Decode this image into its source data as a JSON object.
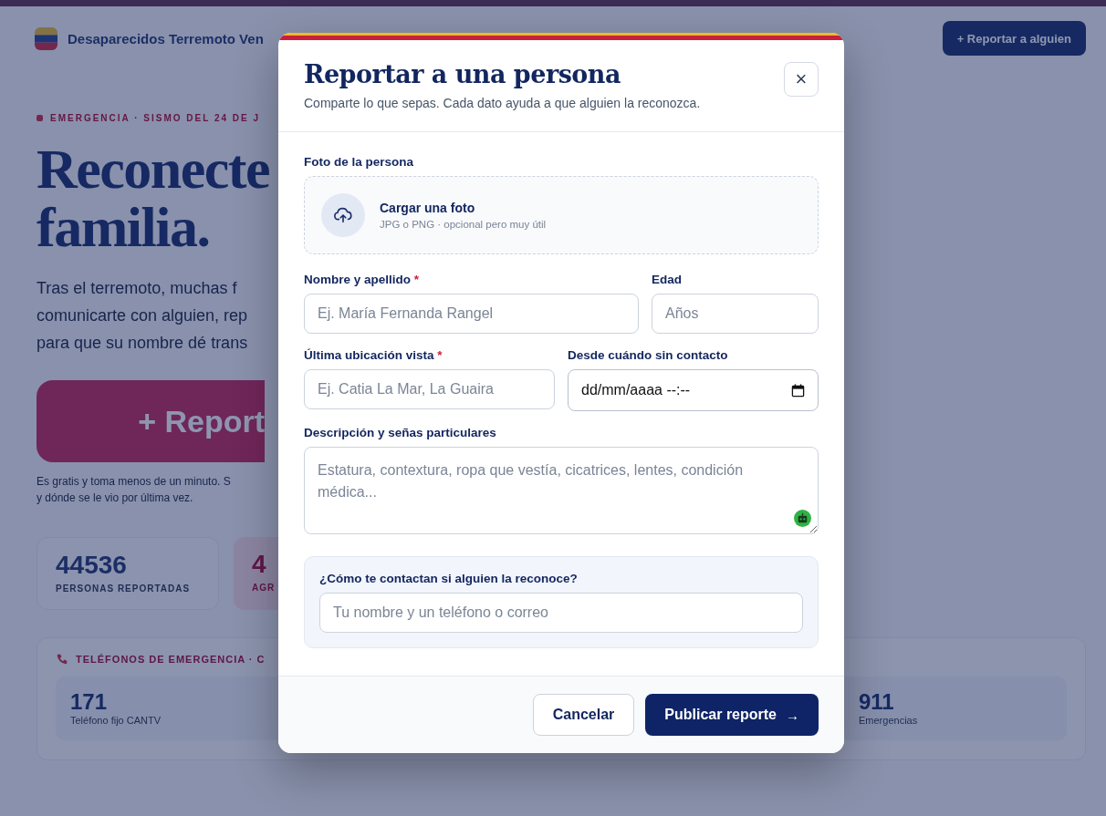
{
  "page": {
    "brand": "Desaparecidos Terremoto Ven",
    "header_button": {
      "icon": "+",
      "label": "Reportar a alguien"
    },
    "eyebrow": "EMERGENCIA · SISMO DEL 24 DE J",
    "headline": [
      "Reconecte",
      "familia."
    ],
    "intro": [
      "Tras el terremoto, muchas f",
      "comunicarte con alguien, rep",
      "para que su nombre dé trans"
    ],
    "cta": {
      "icon": "+",
      "label": "Report"
    },
    "cta_note": [
      "Es gratis y toma menos de un minuto. S",
      "y dónde se le vio por última vez."
    ],
    "stats": [
      {
        "value": "44536",
        "label": "PERSONAS REPORTADAS",
        "kind": "plain"
      },
      {
        "value": "4",
        "label": "AGR",
        "kind": "alert"
      }
    ],
    "phones": {
      "title": "TELÉFONOS DE EMERGENCIA · C",
      "items": [
        {
          "number": "171",
          "label": "Teléfono fijo CANTV"
        },
        {
          "number": "911",
          "label": "Emergencias"
        }
      ]
    }
  },
  "modal": {
    "required_mark": "*",
    "title": "Reportar a una persona",
    "subtitle": "Comparte lo que sepas. Cada dato ayuda a que alguien la reconozca.",
    "close": "×",
    "photo": {
      "label": "Foto de la persona",
      "title": "Cargar una foto",
      "hint": "JPG o PNG · opcional pero muy útil"
    },
    "rows": [
      [
        {
          "kind": "text",
          "label": "Nombre y apellido",
          "required": true,
          "placeholder": "Ej. María Fernanda Rangel"
        },
        {
          "kind": "text",
          "label": "Edad",
          "required": false,
          "placeholder": "Años"
        }
      ],
      [
        {
          "kind": "text",
          "label": "Última ubicación vista",
          "required": true,
          "placeholder": "Ej. Catia La Mar, La Guaira"
        },
        {
          "kind": "datetime",
          "label": "Desde cuándo sin contacto",
          "required": false,
          "value": "dd/mm/aaaa --:--"
        }
      ],
      [
        {
          "kind": "textarea",
          "label": "Descripción y señas particulares",
          "required": false,
          "placeholder": "Estatura, contextura, ropa que vestía, cicatrices, lentes, condición médica..."
        }
      ]
    ],
    "contact": {
      "label": "¿Cómo te contactan si alguien la reconoce?",
      "placeholder": "Tu nombre y un teléfono o correo"
    },
    "buttons": [
      {
        "kind": "secondary",
        "label": "Cancelar"
      },
      {
        "kind": "primary",
        "label": "Publicar reporte",
        "icon": "→"
      }
    ]
  }
}
